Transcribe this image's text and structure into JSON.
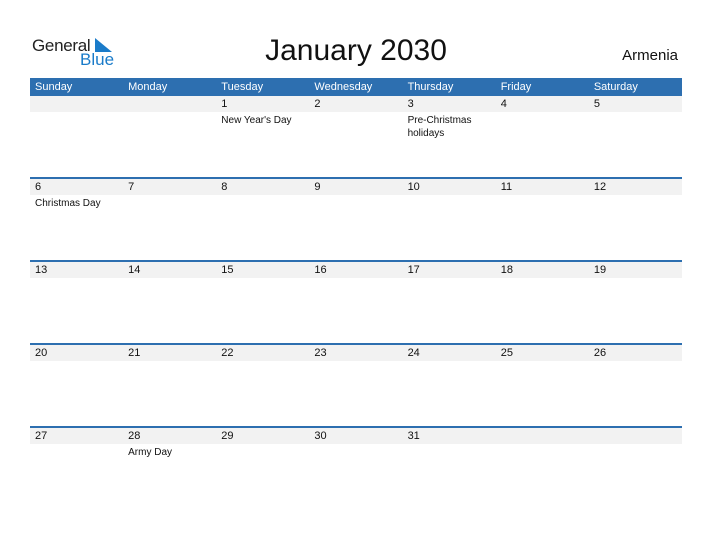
{
  "logo": {
    "general": "General",
    "blue": "Blue"
  },
  "title": "January 2030",
  "country": "Armenia",
  "weekdays": [
    "Sunday",
    "Monday",
    "Tuesday",
    "Wednesday",
    "Thursday",
    "Friday",
    "Saturday"
  ],
  "weeks": [
    [
      {
        "day": "",
        "event": ""
      },
      {
        "day": "",
        "event": ""
      },
      {
        "day": "1",
        "event": "New Year's Day"
      },
      {
        "day": "2",
        "event": ""
      },
      {
        "day": "3",
        "event": "Pre-Christmas holidays"
      },
      {
        "day": "4",
        "event": ""
      },
      {
        "day": "5",
        "event": ""
      }
    ],
    [
      {
        "day": "6",
        "event": "Christmas Day"
      },
      {
        "day": "7",
        "event": ""
      },
      {
        "day": "8",
        "event": ""
      },
      {
        "day": "9",
        "event": ""
      },
      {
        "day": "10",
        "event": ""
      },
      {
        "day": "11",
        "event": ""
      },
      {
        "day": "12",
        "event": ""
      }
    ],
    [
      {
        "day": "13",
        "event": ""
      },
      {
        "day": "14",
        "event": ""
      },
      {
        "day": "15",
        "event": ""
      },
      {
        "day": "16",
        "event": ""
      },
      {
        "day": "17",
        "event": ""
      },
      {
        "day": "18",
        "event": ""
      },
      {
        "day": "19",
        "event": ""
      }
    ],
    [
      {
        "day": "20",
        "event": ""
      },
      {
        "day": "21",
        "event": ""
      },
      {
        "day": "22",
        "event": ""
      },
      {
        "day": "23",
        "event": ""
      },
      {
        "day": "24",
        "event": ""
      },
      {
        "day": "25",
        "event": ""
      },
      {
        "day": "26",
        "event": ""
      }
    ],
    [
      {
        "day": "27",
        "event": ""
      },
      {
        "day": "28",
        "event": "Army Day"
      },
      {
        "day": "29",
        "event": ""
      },
      {
        "day": "30",
        "event": ""
      },
      {
        "day": "31",
        "event": ""
      },
      {
        "day": "",
        "event": ""
      },
      {
        "day": "",
        "event": ""
      }
    ]
  ],
  "colors": {
    "header": "#2d6fb0",
    "brand_blue": "#1a7bc9",
    "day_band": "#f2f2f2"
  }
}
